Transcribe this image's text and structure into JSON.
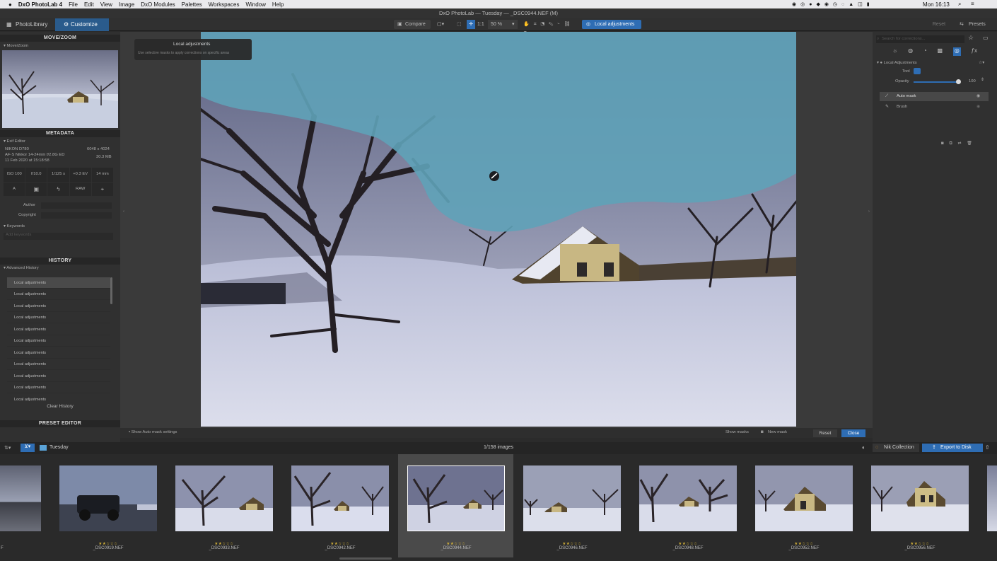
{
  "menubar": {
    "app": "DxO PhotoLab 4",
    "items": [
      "File",
      "Edit",
      "View",
      "Image",
      "DxO Modules",
      "Palettes",
      "Workspaces",
      "Window",
      "Help"
    ],
    "clock": "Mon 16:13"
  },
  "window_title": "DxO PhotoLab — Tuesday — _DSC0944.NEF (M)",
  "tabs": {
    "library": "PhotoLibrary",
    "customize": "Customize"
  },
  "toolbar": {
    "compare": "Compare",
    "zoom_fit": "1:1",
    "zoom_value": "50 %",
    "local_adjustments": "Local adjustments",
    "reset": "Reset",
    "presets": "Presets"
  },
  "left": {
    "move_zoom_title": "MOVE/ZOOM",
    "move_zoom_sub": "Move/Zoom",
    "metadata_title": "METADATA",
    "exif_editor": "Exif Editor",
    "camera": "NIKON D780",
    "lens": "AF-S Nikkor 14-24mm f/2.8G ED",
    "date": "11 Feb 2020 at 15:18:58",
    "dimensions": "6048 x 4024",
    "filesize": "30.3 MB",
    "exif": [
      "ISO 100",
      "f/10.0",
      "1/125 s",
      "+0.3 EV",
      "14 mm"
    ],
    "exif_icons": [
      "A",
      "",
      "",
      "RAW",
      ""
    ],
    "author_label": "Author",
    "copyright_label": "Copyright",
    "keywords_label": "Keywords",
    "add_keywords": "Add keywords",
    "history_title": "HISTORY",
    "advanced_history": "Advanced History",
    "history_items": [
      "Local adjustments",
      "Local adjustments",
      "Local adjustments",
      "Local adjustments",
      "Local adjustments",
      "Local adjustments",
      "Local adjustments",
      "Local adjustments",
      "Local adjustments",
      "Local adjustments",
      "Local adjustments"
    ],
    "clear_history": "Clear History",
    "preset_editor": "PRESET EDITOR"
  },
  "tooltip": {
    "title": "Local adjustments",
    "text": "Use selective masks to apply corrections on specific areas"
  },
  "bottom_controls": {
    "show_automask": "Show Auto mask settings",
    "show_masks": "Show masks",
    "new_mask": "New mask",
    "reset": "Reset",
    "close": "Close"
  },
  "right": {
    "search_placeholder": "Search for corrections...",
    "section": "Local Adjustments",
    "tool_label": "Tool",
    "opacity_label": "Opacity",
    "opacity_value": "100",
    "opacity_level": 1.0,
    "masks": [
      "Auto mask",
      "Brush"
    ]
  },
  "filmbar": {
    "folder": "Tuesday",
    "count": "1/158 images",
    "nik": "Nik Collection",
    "export": "Export to Disk"
  },
  "filmstrip": [
    {
      "name": "F",
      "stars": ""
    },
    {
      "name": "_DSC0919.NEF",
      "stars": "★★☆☆☆"
    },
    {
      "name": "_DSC0933.NEF",
      "stars": "★★☆☆☆"
    },
    {
      "name": "_DSC0942.NEF",
      "stars": "★★☆☆☆"
    },
    {
      "name": "_DSC0944.NEF",
      "stars": "★★☆☆☆"
    },
    {
      "name": "_DSC0946.NEF",
      "stars": "★★☆☆☆"
    },
    {
      "name": "_DSC0948.NEF",
      "stars": "★★☆☆☆"
    },
    {
      "name": "_DSC0952.NEF",
      "stars": "★★☆☆☆"
    },
    {
      "name": "_DSC0956.NEF",
      "stars": "★★☆☆☆"
    }
  ],
  "colors": {
    "accent": "#2e6db4",
    "mask": "#5fa2b8",
    "active_tab": "#2a5b8c"
  }
}
